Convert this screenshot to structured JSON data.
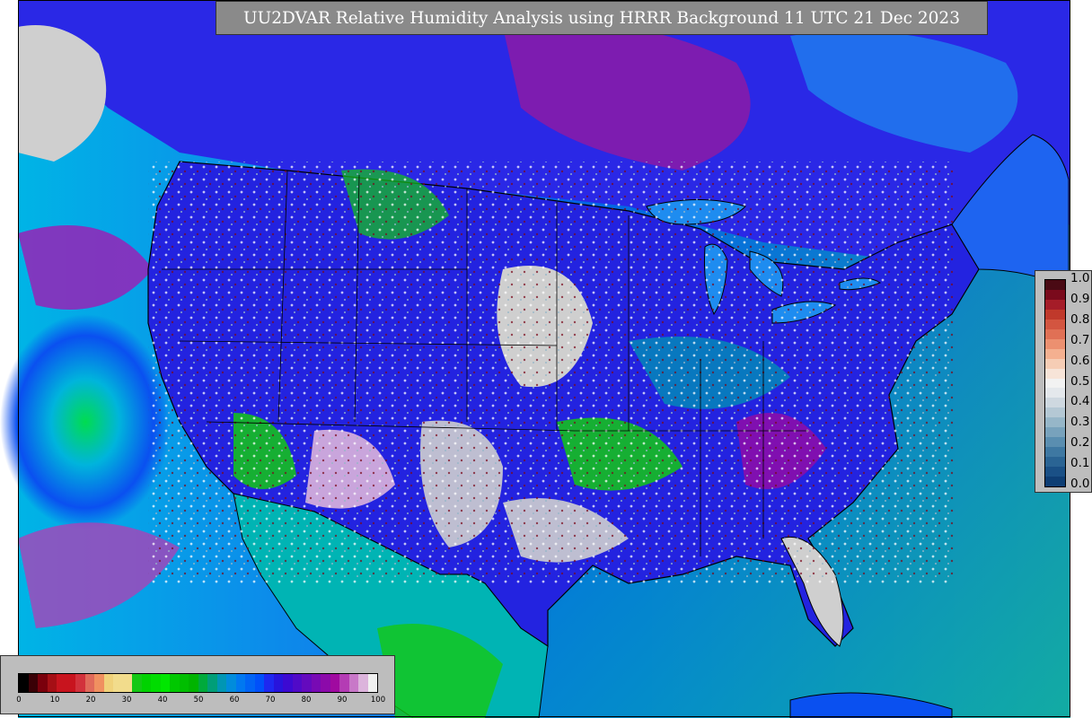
{
  "title": "UU2DVAR Relative Humidity Analysis using HRRR Background 11 UTC 21 Dec 2023",
  "colors": {
    "land_no_data": "#cfcfcf",
    "ocean_moist": "#00c8c8",
    "very_moist": "#8c1aa6",
    "moist_blue": "#1414e6",
    "mid_green": "#14c814",
    "border_lines": "#000000"
  },
  "rh_colorbar": {
    "label_ticks": [
      "0",
      "10",
      "20",
      "30",
      "40",
      "50",
      "60",
      "70",
      "80",
      "90",
      "100"
    ],
    "colors": [
      "#000000",
      "#3a0006",
      "#7a000c",
      "#a50f15",
      "#c8141e",
      "#c8141e",
      "#d2323c",
      "#e06a5a",
      "#f09060",
      "#f0d27a",
      "#f2dc8c",
      "#f2dc8c",
      "#14c814",
      "#00d200",
      "#00dc00",
      "#00e600",
      "#00c800",
      "#00be00",
      "#00b400",
      "#00aa3c",
      "#009e78",
      "#0096b4",
      "#008cdc",
      "#0078f0",
      "#0064f5",
      "#0050fa",
      "#1e28f0",
      "#2814dc",
      "#3c0ad2",
      "#500ac8",
      "#640abe",
      "#780ab4",
      "#8c0aaa",
      "#a00aa0",
      "#b43cb4",
      "#c878c8",
      "#dcb4dc",
      "#f0f0f0"
    ]
  },
  "obs_colorbar": {
    "label_ticks": [
      "0.0",
      "0.1",
      "0.2",
      "0.3",
      "0.4",
      "0.5",
      "0.6",
      "0.7",
      "0.8",
      "0.9",
      "1.0"
    ],
    "colors_top_to_bottom": [
      "#4a0a14",
      "#7a0a1c",
      "#a51c28",
      "#c0392b",
      "#d35540",
      "#e07055",
      "#ec9070",
      "#f4b090",
      "#f6cdb5",
      "#f7e4d8",
      "#f2f2f2",
      "#e4e8ec",
      "#ced8e0",
      "#b4c8d4",
      "#96b6c8",
      "#78a2bc",
      "#5a8eb0",
      "#3e78a2",
      "#2a6494",
      "#1a5086",
      "#0e3e74"
    ]
  }
}
